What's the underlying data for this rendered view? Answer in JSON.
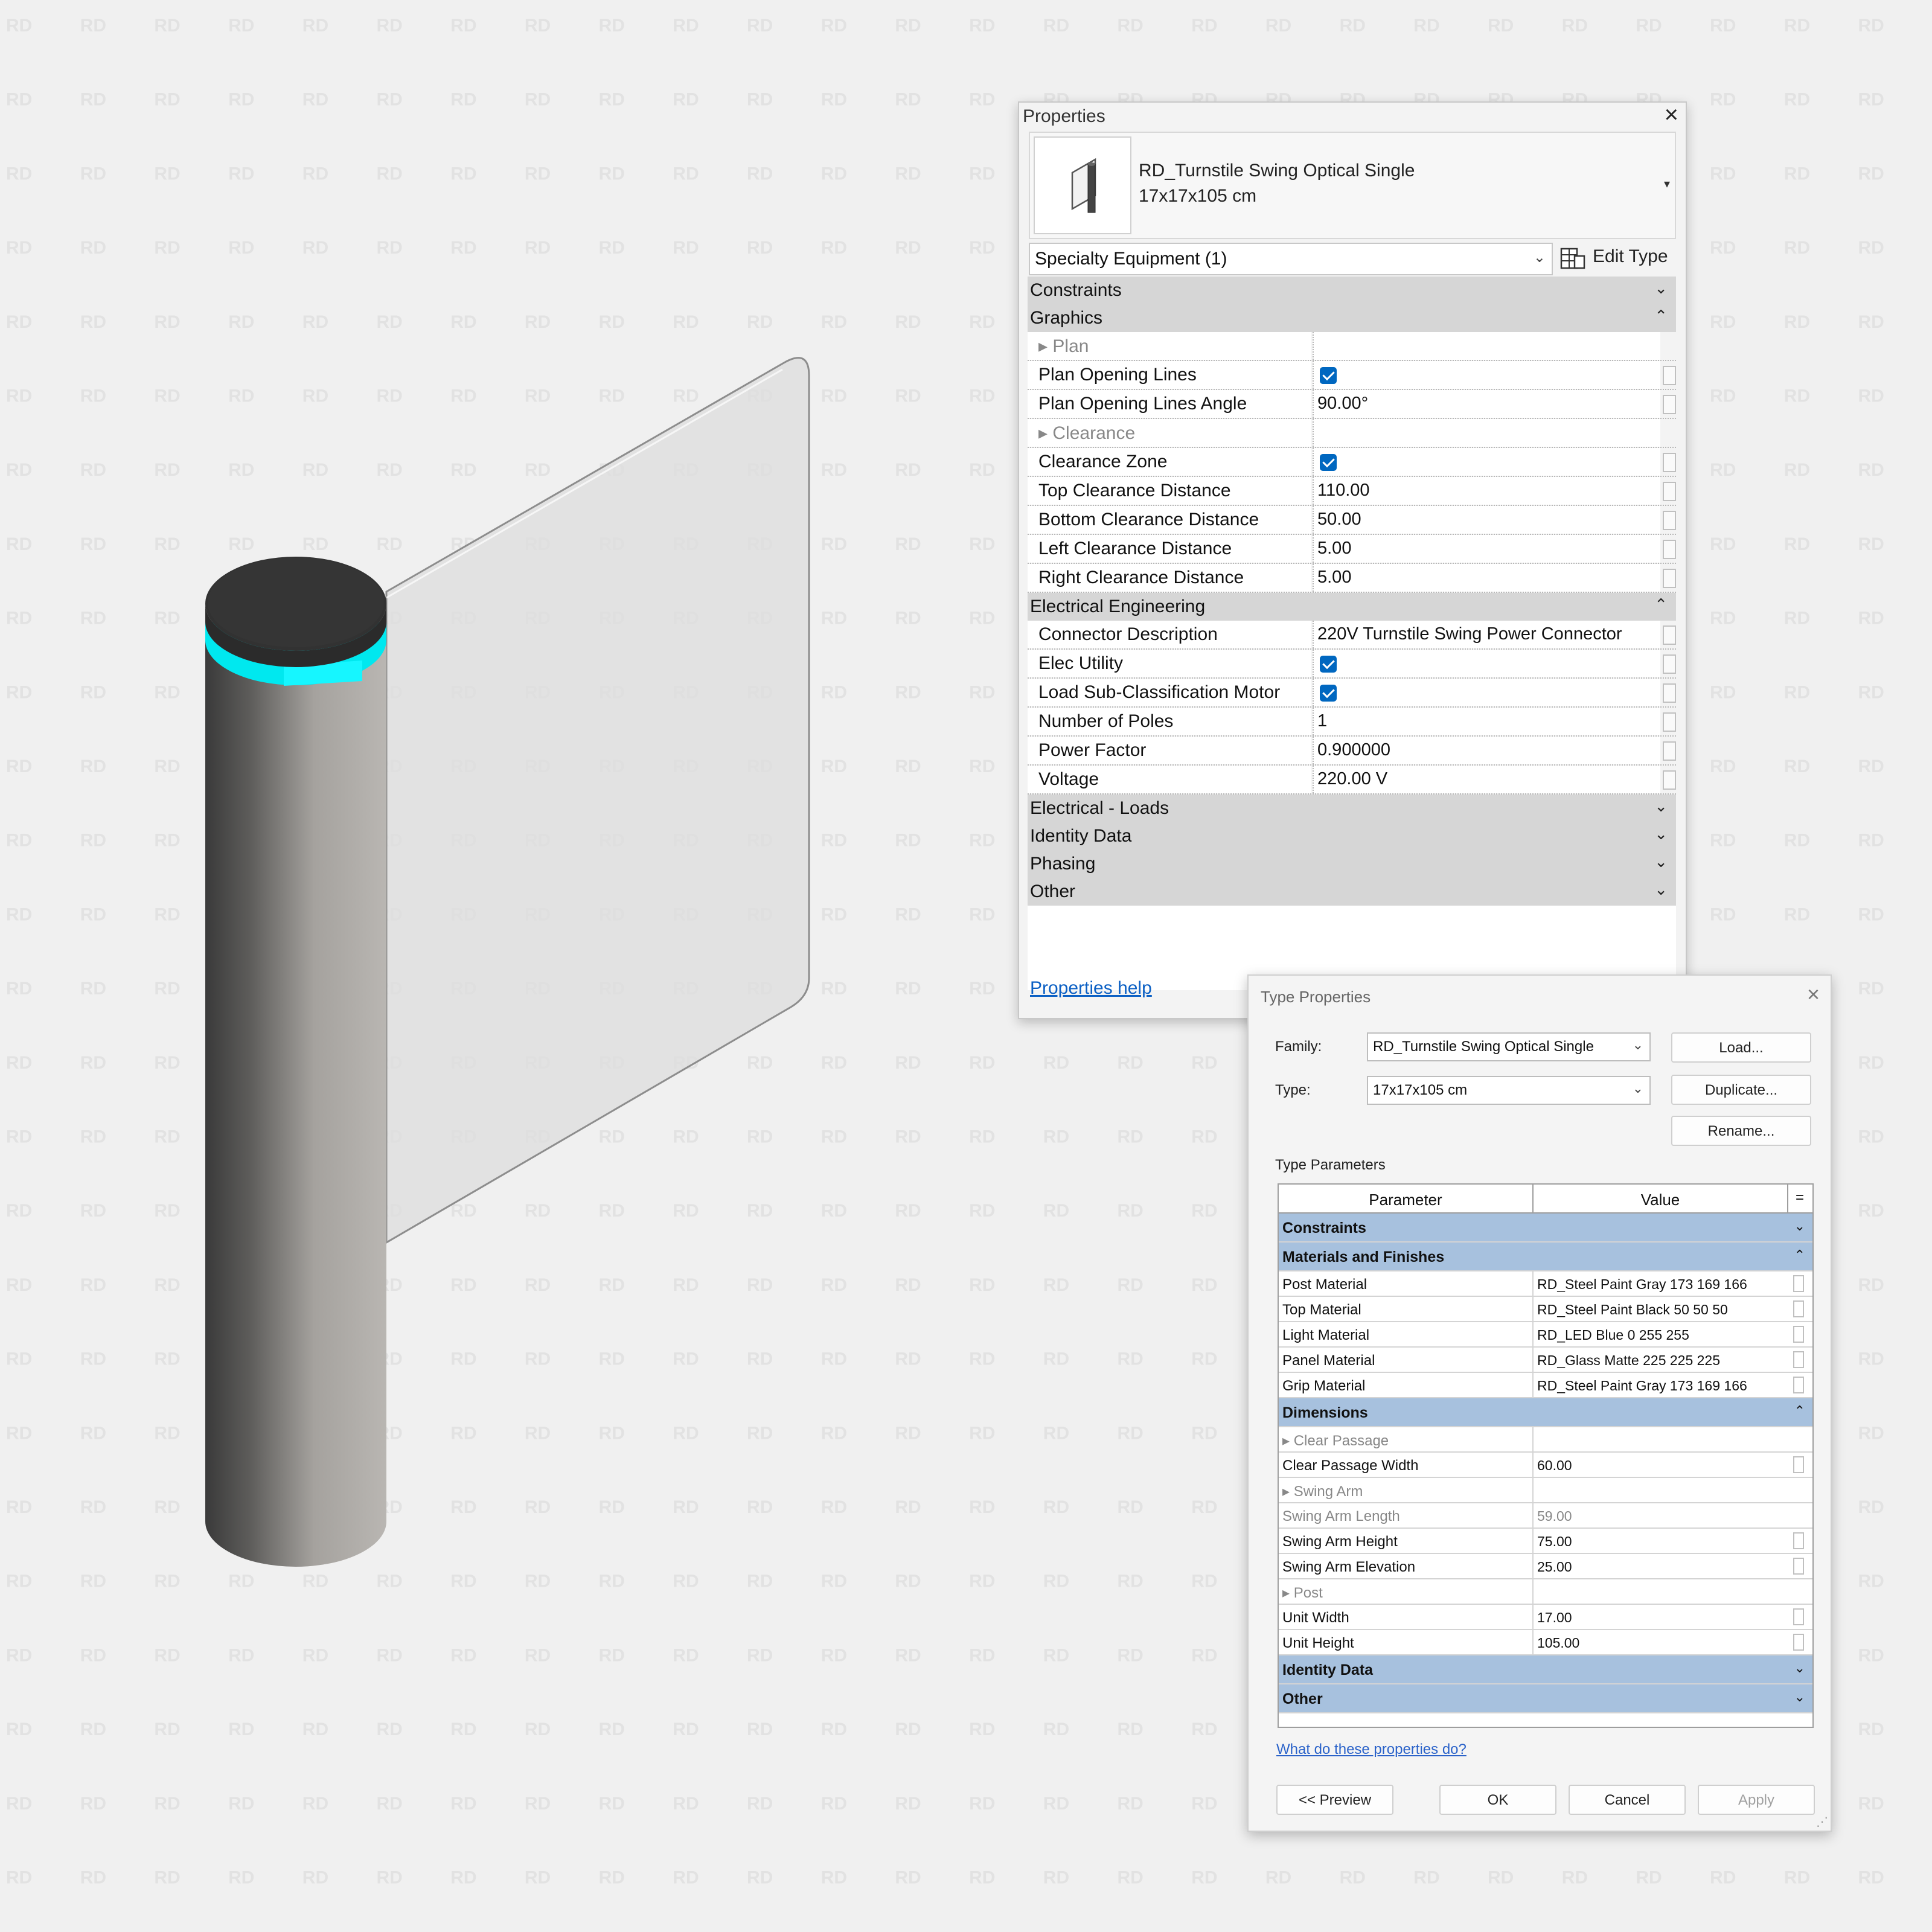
{
  "watermark": {
    "text": "RD"
  },
  "colors": {
    "post": "#adaaa6",
    "top": "#323232",
    "light": "#00ffff",
    "panel": "#e1e1e1",
    "group_header_properties": "#d6d6d6",
    "group_header_type": "#a7c1de",
    "checkbox": "#0067c0",
    "link": "#0a5fc4"
  },
  "properties": {
    "title": "Properties",
    "close_icon": "×",
    "type_name": "RD_Turnstile Swing Optical Single",
    "type_size": "17x17x105 cm",
    "type_caret": "▾",
    "category": "Specialty Equipment (1)",
    "category_chevron": "⌄",
    "edit_type_label": "Edit Type",
    "help_link": "Properties help",
    "groups": {
      "constraints": {
        "name": "Constraints",
        "toggle": "⌄"
      },
      "graphics": {
        "name": "Graphics",
        "toggle": "⌃"
      },
      "electrical": {
        "name": "Electrical Engineering",
        "toggle": "⌃"
      },
      "elec_loads": {
        "name": "Electrical - Loads",
        "toggle": "⌄"
      },
      "identity": {
        "name": "Identity Data",
        "toggle": "⌄"
      },
      "phasing": {
        "name": "Phasing",
        "toggle": "⌄"
      },
      "other": {
        "name": "Other",
        "toggle": "⌄"
      }
    },
    "rows": {
      "plan_sub": "▸ Plan",
      "plan_opening_lines": "Plan Opening Lines",
      "plan_opening_lines_angle": "Plan Opening Lines Angle",
      "plan_opening_lines_angle_value": "90.00°",
      "clearance_sub": "▸ Clearance",
      "clearance_zone": "Clearance Zone",
      "top_clearance": "Top Clearance Distance",
      "top_clearance_value": "110.00",
      "bottom_clearance": "Bottom Clearance Distance",
      "bottom_clearance_value": "50.00",
      "left_clearance": "Left Clearance Distance",
      "left_clearance_value": "5.00",
      "right_clearance": "Right Clearance Distance",
      "right_clearance_value": "5.00",
      "connector_description": "Connector Description",
      "connector_description_value": "220V Turnstile Swing Power Connector",
      "elec_utility": "Elec Utility",
      "load_sub_classification": "Load Sub-Classification Motor",
      "number_of_poles": "Number of Poles",
      "number_of_poles_value": "1",
      "power_factor": "Power Factor",
      "power_factor_value": "0.900000",
      "voltage": "Voltage",
      "voltage_value": "220.00 V"
    },
    "checkbox_states": {
      "plan_opening_lines": true,
      "clearance_zone": true,
      "elec_utility": true,
      "load_sub_classification": true
    }
  },
  "type_properties": {
    "title": "Type Properties",
    "close_icon": "×",
    "family_label": "Family:",
    "family_value": "RD_Turnstile Swing Optical Single",
    "type_label": "Type:",
    "type_value": "17x17x105 cm",
    "combo_chevron": "⌄",
    "load_button": "Load...",
    "duplicate_button": "Duplicate...",
    "rename_button": "Rename...",
    "type_parameters_label": "Type Parameters",
    "col_parameter": "Parameter",
    "col_value": "Value",
    "col_equals": "=",
    "groups": {
      "constraints": {
        "name": "Constraints",
        "toggle": "⌄"
      },
      "materials": {
        "name": "Materials and Finishes",
        "toggle": "⌃"
      },
      "dimensions": {
        "name": "Dimensions",
        "toggle": "⌃"
      },
      "identity": {
        "name": "Identity Data",
        "toggle": "⌄"
      },
      "other": {
        "name": "Other",
        "toggle": "⌄"
      }
    },
    "rows": {
      "post_material": "Post Material",
      "post_material_value": "RD_Steel Paint Gray 173 169 166",
      "top_material": "Top Material",
      "top_material_value": "RD_Steel Paint Black 50 50 50",
      "light_material": "Light Material",
      "light_material_value": "RD_LED Blue 0 255 255",
      "panel_material": "Panel Material",
      "panel_material_value": "RD_Glass Matte 225 225 225",
      "grip_material": "Grip Material",
      "grip_material_value": "RD_Steel Paint Gray 173 169 166",
      "clear_passage_sub": "▸ Clear Passage",
      "clear_passage_width": "Clear Passage Width",
      "clear_passage_width_value": "60.00",
      "swing_arm_sub": "▸ Swing Arm",
      "swing_arm_length": "Swing Arm Length",
      "swing_arm_length_value": "59.00",
      "swing_arm_height": "Swing Arm Height",
      "swing_arm_height_value": "75.00",
      "swing_arm_elevation": "Swing Arm Elevation",
      "swing_arm_elevation_value": "25.00",
      "post_sub": "▸ Post",
      "unit_width": "Unit Width",
      "unit_width_value": "17.00",
      "unit_height": "Unit Height",
      "unit_height_value": "105.00"
    },
    "help_link": "What do these properties do?",
    "preview_button": "<< Preview",
    "ok_button": "OK",
    "cancel_button": "Cancel",
    "apply_button": "Apply",
    "resize_grip": "⋰"
  }
}
